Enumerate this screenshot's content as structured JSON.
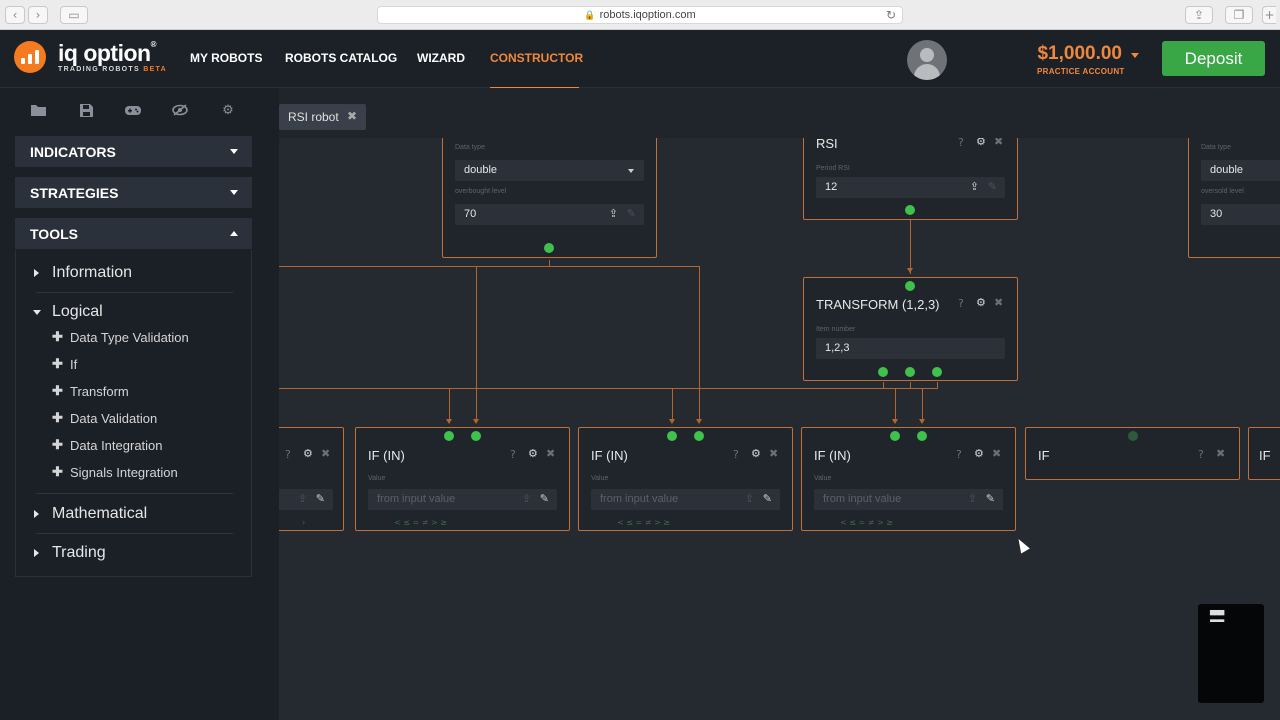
{
  "browser": {
    "url": "robots.iqoption.com",
    "back_icon": "chevron-left-icon",
    "forward_icon": "chevron-right-icon",
    "sidebar_icon": "sidebar-icon",
    "reload_icon": "reload-icon",
    "share_icon": "share-icon",
    "tabs_icon": "tabs-icon"
  },
  "header": {
    "brand": "iq option",
    "brand_mark": "®",
    "brand_sub": "TRADING ROBOTS",
    "brand_beta": "BETA",
    "nav": [
      {
        "label": "MY ROBOTS",
        "active": false
      },
      {
        "label": "ROBOTS CATALOG",
        "active": false
      },
      {
        "label": "WIZARD",
        "active": false
      },
      {
        "label": "CONSTRUCTOR",
        "active": true
      }
    ],
    "balance": "$1,000.00",
    "account_type": "PRACTICE ACCOUNT",
    "deposit_label": "Deposit",
    "accent_color": "#f0883c",
    "deposit_color": "#3aa746"
  },
  "sidebar": {
    "toolbar": [
      "folder-icon",
      "save-icon",
      "gamepad-icon",
      "eye-off-icon",
      "gear-icon"
    ],
    "sections": [
      {
        "label": "INDICATORS",
        "expanded": false
      },
      {
        "label": "STRATEGIES",
        "expanded": false
      },
      {
        "label": "TOOLS",
        "expanded": true
      }
    ],
    "categories": [
      {
        "label": "Information",
        "expanded": false
      },
      {
        "label": "Logical",
        "expanded": true,
        "items": [
          "Data Type Validation",
          "If",
          "Transform",
          "Data Validation",
          "Data Integration",
          "Signals Integration"
        ]
      },
      {
        "label": "Mathematical",
        "expanded": false
      },
      {
        "label": "Trading",
        "expanded": false
      }
    ]
  },
  "workspace": {
    "tab_label": "RSI robot",
    "nodes": {
      "overbought": {
        "data_type_label": "Data type",
        "data_type": "double",
        "level_label": "overbought level",
        "level": "70"
      },
      "rsi": {
        "title": "RSI",
        "period_label": "Period RSI",
        "period": "12"
      },
      "oversold": {
        "data_type_label": "Data type",
        "data_type": "double",
        "level_label": "oversold level",
        "level": "30"
      },
      "transform": {
        "title": "TRANSFORM (1,2,3)",
        "item_label": "Item number",
        "item": "1,2,3"
      },
      "if_in": {
        "title": "IF (IN)",
        "value_label": "Value",
        "placeholder": "from input value",
        "ops": "<  ≤  =  ≠  >  ≥"
      },
      "if": {
        "title": "IF"
      }
    }
  }
}
